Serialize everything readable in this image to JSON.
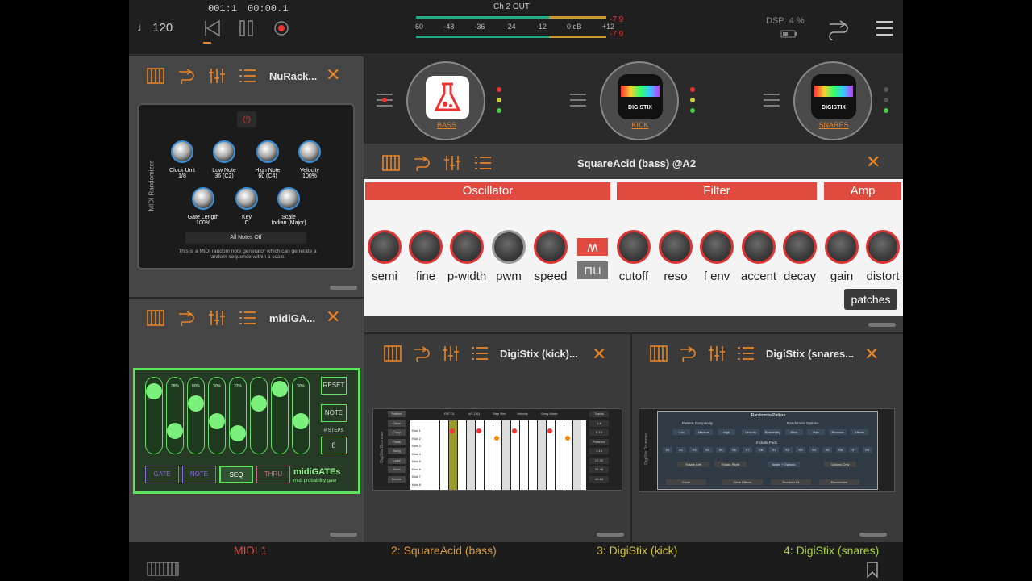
{
  "transport": {
    "tempo": "♩ 120",
    "position": "001:1",
    "time": "00:00.1"
  },
  "meter": {
    "title": "Ch 2 OUT",
    "scale": [
      "-60",
      "-48",
      "-36",
      "-24",
      "-12",
      "0 dB",
      "+12"
    ],
    "peak_l": "-7.9",
    "peak_r": "-7.9"
  },
  "dsp": {
    "label": "DSP: 4 %"
  },
  "midi_plugin": {
    "title": "NuRack...",
    "side_label": "MIDI Randomizer",
    "knobs": [
      {
        "name": "Clock Unit",
        "value": "1/8"
      },
      {
        "name": "Low Note",
        "value": "36 (C2)"
      },
      {
        "name": "High Note",
        "value": "60 (C4)"
      },
      {
        "name": "Velocity",
        "value": "100%"
      },
      {
        "name": "Gate Length",
        "value": "100%"
      },
      {
        "name": "Key",
        "value": "C"
      },
      {
        "name": "Scale",
        "value": "Iodian (Major)"
      }
    ],
    "notes_off": "All Notes Off",
    "description": "This is a MIDI random note generator which can generate a random sequence within a scale."
  },
  "gates_plugin": {
    "title": "midiGA...",
    "faders": [
      {
        "pct": "",
        "pos": 0.1
      },
      {
        "pct": "28%",
        "pos": 0.75
      },
      {
        "pct": "80%",
        "pos": 0.3
      },
      {
        "pct": "30%",
        "pos": 0.6
      },
      {
        "pct": "22%",
        "pos": 0.8
      },
      {
        "pct": "",
        "pos": 0.3
      },
      {
        "pct": "",
        "pos": 0.05
      },
      {
        "pct": "30%",
        "pos": 0.6
      }
    ],
    "reset": "RESET",
    "note": "NOTE",
    "steps_label": "# STEPS",
    "steps": "8",
    "tabs": [
      "GATE",
      "NOTE",
      "SEQ",
      "THRU"
    ],
    "brand": "midiGATEs",
    "sub": "midi probability gate"
  },
  "channels": [
    {
      "name": "BASS",
      "icon": "flask-icon"
    },
    {
      "name": "KICK",
      "icon": "digistix-icon",
      "brand": "DIGISTIX"
    },
    {
      "name": "SNARES",
      "icon": "digistix-icon",
      "brand": "DIGISTIX"
    }
  ],
  "square": {
    "title": "SquareAcid (bass) @A2",
    "sections": [
      "Oscillator",
      "Filter",
      "Amp"
    ],
    "knobs": [
      "semi",
      "fine",
      "p-width",
      "pwm",
      "speed",
      "cutoff",
      "reso",
      "f env",
      "accent",
      "decay",
      "gain",
      "distort"
    ],
    "patches": "patches"
  },
  "kick": {
    "title": "DigiStix (kick)...",
    "side": "DigiStix Drummer",
    "buttons": [
      "Pattern",
      "Clear",
      "Copy",
      "Paste",
      "Song",
      "Load",
      "Save",
      "Delete"
    ],
    "toolbar": [
      "PAT 01",
      "4/4 (16)",
      "Step Rec",
      "Velocity",
      "Song Mode"
    ],
    "rows": [
      "Kick 1",
      "Kick 2",
      "Kick 3",
      "Kick 4",
      "Kick 5",
      "Kick 6",
      "Kick 7",
      "Kick 8"
    ],
    "right": [
      "Tracks",
      "1-8",
      "9-16",
      "Patterns",
      "1-16",
      "17-32",
      "33-48",
      "49-64"
    ]
  },
  "snares": {
    "title": "DigiStix (snares...",
    "side": "DigiStix Drummer",
    "dialog_title": "Randomize Pattern",
    "complexity_label": "Pattern Complexity",
    "options_label": "Randomize Options",
    "complexity": [
      "Low",
      "Medium",
      "High"
    ],
    "options": [
      "Velocity",
      "Probability",
      "Pitch",
      "Pan",
      "Reverse",
      "Effects"
    ],
    "pads_label": "Include Pads",
    "pads": [
      "S1",
      "S2",
      "S3",
      "S4",
      "S5",
      "S6",
      "S7",
      "S8",
      "S1",
      "S2",
      "S3",
      "S4",
      "S5",
      "S6",
      "S7",
      "S8"
    ],
    "rotate_left": "Rotate Left",
    "rotate_right": "Rotate Right",
    "notes_options": "Notes + Options",
    "options_only": "Options Only",
    "close": "Close",
    "clear": "Clear Effects",
    "random_kit": "Random Kit",
    "randomize": "Randomize"
  },
  "tabs": [
    {
      "label": "MIDI 1",
      "color": "#d94a3a"
    },
    {
      "label": "2: SquareAcid (bass)",
      "color": "#d79a3a"
    },
    {
      "label": "3: DigiStix (kick)",
      "color": "#d2c23a"
    },
    {
      "label": "4: DigiStix (snares)",
      "color": "#a8d23a"
    }
  ]
}
